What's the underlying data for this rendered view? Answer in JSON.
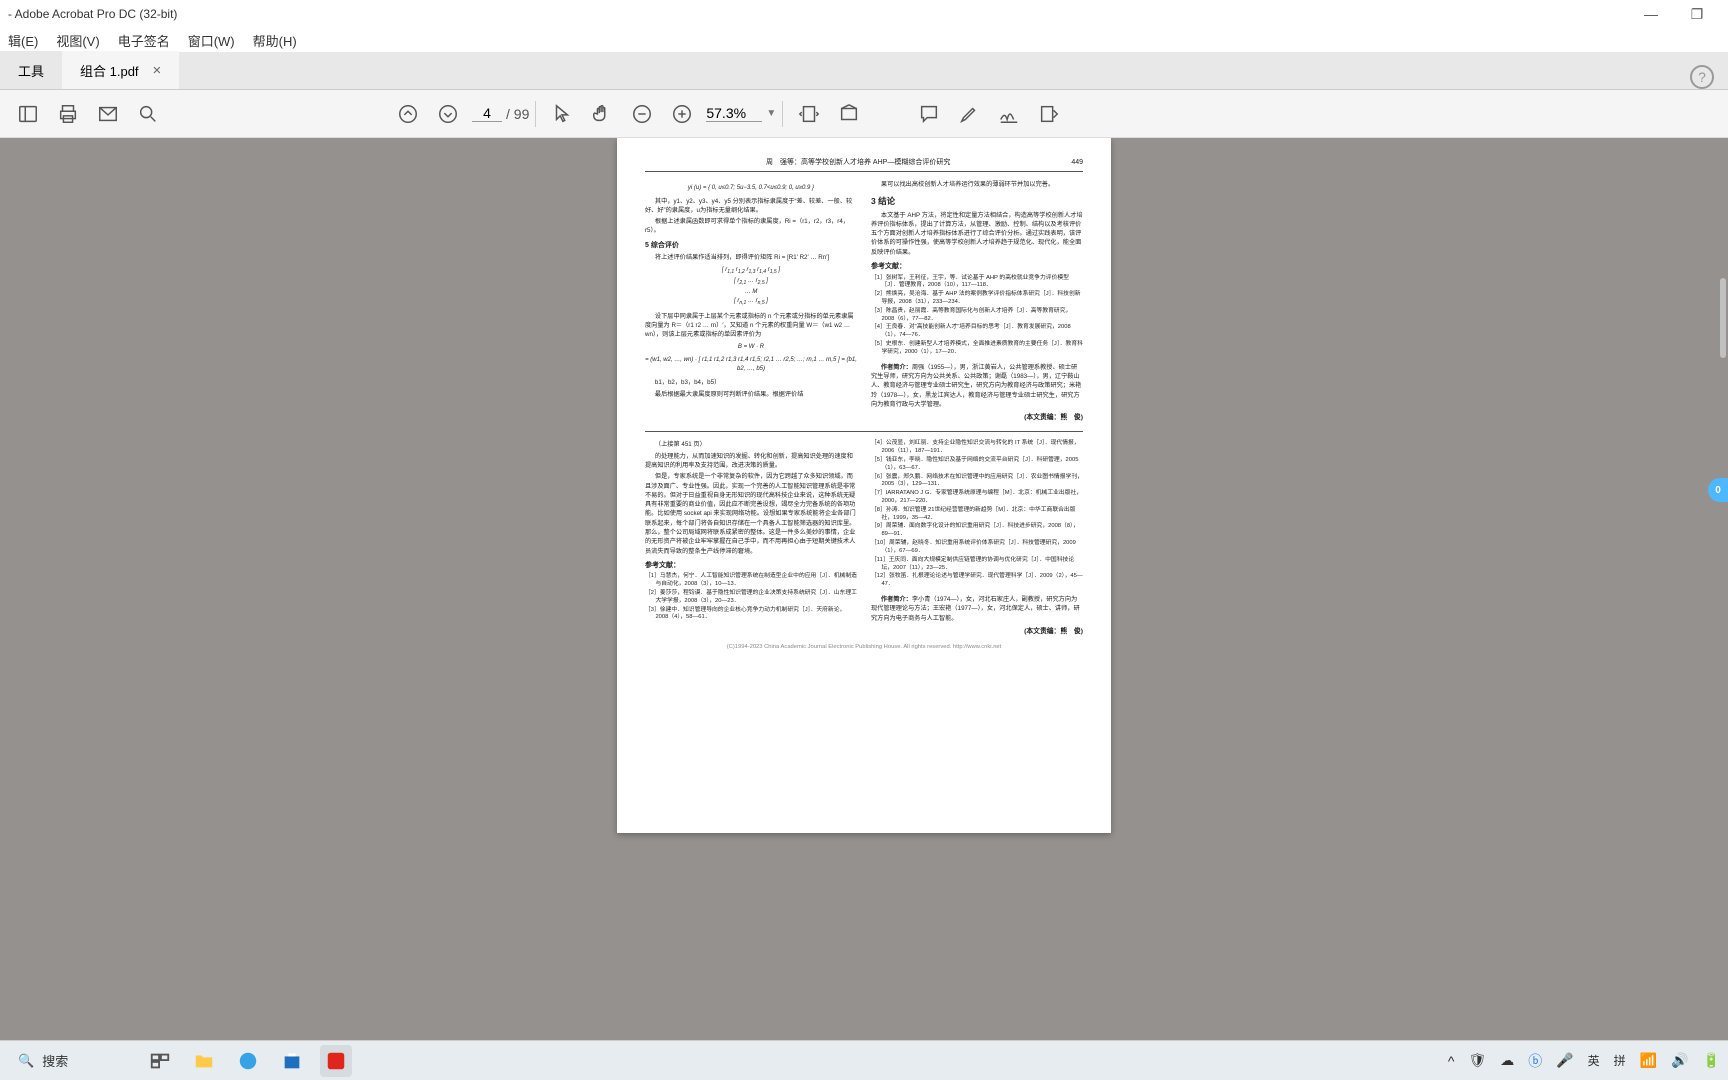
{
  "window": {
    "title": "- Adobe Acrobat Pro DC (32-bit)",
    "minimize": "—",
    "maximize": "❐",
    "close": "✕"
  },
  "menu": {
    "edit": "辑(E)",
    "view": "视图(V)",
    "esign": "电子签名",
    "window": "窗口(W)",
    "help": "帮助(H)"
  },
  "tabs": {
    "home": "工具",
    "file": "组合 1.pdf",
    "close": "×",
    "help_icon": "?"
  },
  "toolbar": {
    "page_current": "4",
    "page_sep": "/",
    "page_total": "99",
    "zoom_value": "57.3%"
  },
  "doc": {
    "running_head_center": "周　强等：高等学校创新人才培养 AHP—模糊综合评价研究",
    "page_no": "449",
    "left": {
      "formula1": "yi (u) = { 0, u≤0.7; 5u−3.5, 0.7<u≤0.9; 0, u≥0.9 }",
      "p1": "其中，y1、y2、y3、y4、y5 分别表示指标隶属度于“差、较差、一般、较好、好”的隶属度，u为指标无量纲化结果。",
      "p2": "根据上述隶属函数即可求得单个指标的隶属度，Ri =（r1，r2，r3，r4，r5）。",
      "head5": "5  综合评价",
      "p3": "将上述评价结果作适当排列，即得评价矩阵 Ri = [R1′ R2′ … Rn′]",
      "p4": "设下层中同隶属于上层某个元素或指标的 n 个元素或分指标的单元素隶属度向量为 R＝（r1 r2 … rn）′，又知道 n 个元素的权重向量 W＝（w1 w2 … wn），则该上层元素或指标的单因素评价为",
      "formula2": "B = W · R",
      "formula3": "= (w1, w2, …, wn) · [ r1,1 r1,2 r1,3 r1,4 r1,5; r2,1 … r2,5; …; rn,1 … rn,5 ] = (b1, b2, …, b5)",
      "p5": "b1，b2，b3，b4，b5）",
      "p6": "最后根据最大隶属度原则可判断评价结果。根据评价结"
    },
    "right": {
      "p1": "果可以找出高校创新人才培养运行效果的薄弱环节并加以完善。",
      "head3": "3  结论",
      "p2": "本文基于 AHP 方法，将定性和定量方法相结合，构造高等学校创新人才培养评价指标体系，提出了计算方法，从管理、激励、控制、结构以及考核评价五个方面对创新人才培养指标体系进行了综合评价分析。通过实践表明，该评价体系的可操作性强，使高等学校创新人才培养趋于规范化、现代化，能全面反映评价结果。",
      "refs_title": "参考文献：",
      "refs": [
        "［1］张树军，王利征，王宇，等．试论基于 AHP 的高校就业竞争力评价模型［J］．管理教育，2008（10），117—118．",
        "［2］熊焕亮，吴沧海．基于 AHP 法的案例教学评价指标体系研究［J］．科技创新导报，2008（31），233—234．",
        "［3］陈昌贵，赵丽霞．高等教育国际化与创新人才培养［J］．高等教育研究，2008（6），77—82．",
        "［4］王良春．对“高技能创新人才”培养目标的思考［J］．教育发展研究，2008（1），74—76．",
        "［5］史根东．创建新型人才培养模式，全面推进素质教育的主要任务［J］．教育科学研究，2000（1），17—20．"
      ],
      "author_bio_title": "作者简介：",
      "author_bio": "周强（1955—），男，浙江黄岩人，公共管理系教授、硕士研究生导师，研究方向为公共关系、公共政策；谢磊（1983—），男，辽宁鞍山人、教育经济与管理专业硕士研究生，研究方向为教育经济与政策研究；米艳玲（1978—），女，黑龙江宾达人，教育经济与管理专业硕士研究生，研究方向为教育行政与大学管理。",
      "editor": "(本文责编：熊　俊)"
    },
    "bottom_left": {
      "continue_note": "（上接第 451 页）",
      "p1": "的处理能力，从而加速知识的发掘、转化和创新，提高知识处理的速度和提高知识的利用率及支持范围，改进决策的质量。",
      "p2": "但是，专家系统是一个非常复杂的软件，因为它跨越了众多知识领域，而且涉及面广、专业性强。因此，实现一个完善的人工智能知识管理系统是非常不易的。但对于日益重视自身无形知识的现代高科技企业来说，这种系统无疑具有非常重要的商业价值，因此应不断完善设想，竭尽全力完备系统的各项功能。比如使用 socket api 来实现网络功能。设想如果专家系统能将企业各部门联系起来，每个部门将各自知识存储在一个具备人工智能筛选器的知识库里。那么，整个公司局域网将联系成紧密的整体。这是一件多么美妙的事情，企业的无形资产将被企业牢牢掌握在自己手中，而不用再担心由于短期关键技术人员流失而导致的整条生产线停滞的窘境。",
      "refs_title": "参考文献：",
      "refs": [
        "［1］马慧杰，何宁．人工智能知识管理系统在制造型企业中的应用［J］．机械制造与自动化，2008（3），10—13．",
        "［2］姜莎莎，程钧谟．基于隐性知识管理的企业决策支持系统研究［J］．山东理工大学学报，2008（3），20—23．",
        "［3］徐建中．知识管理导向的企业核心竞争力动力机制研究［J］．天府新论，2008（4），58—61．"
      ]
    },
    "bottom_right": {
      "refs": [
        "［4］公茂显，刘红丽．支持企业隐性知识交流与转化的 IT 系统［J］．现代情报，2006（11），187—191．",
        "［5］钱亚东，李晓．隐性知识及基于网络的交流平台研究［J］．科研管理，2005（1），63—67．",
        "［6］张震，郑久鹏．网络技术在知识管理中的应用研究［J］．农业图书情报学刊，2005（3），129—131．",
        "［7］IARRATANO J G．专家管理系统原理与编程［M］．北京：机械工业出版社，2000，217—220．",
        "［8］孙涛．知识管理 21世纪经营管理的新趋势［M］．北京：中华工商联合出版社，1999，35—42．",
        "［9］周荣辅．面向数字化设计的知识重用研究［J］．科技进步研究，2008（8），89—91．",
        "［10］周荣辅，赵晓冬．知识重用系统评价体系研究［J］．科技管理研究，2009（1），67—69．",
        "［11］王庆同．面向大规模定制供应链管理的协调与优化研究［J］．中国科技论坛，2007（11），23—25．",
        "［12］张牧笛．扎根理论论述与管理学研究．现代管理科学［J］．2009（2），45—47．"
      ],
      "author_bio_title": "作者简介：",
      "author_bio": "李小青（1974—），女，河北石家庄人，副教授，研究方向为现代管理理论与方法；王宏艳（1977—），女，河北保定人，硕士、讲师，研究方向为电子商务与人工智能。",
      "editor": "(本文责编：熊　俊)"
    },
    "footer": "(C)1994-2023 China Academic Journal Electronic Publishing House. All rights reserved.    http://www.cnki.net"
  },
  "floating_badge": "0",
  "taskbar": {
    "search_icon": "🔍",
    "search_placeholder": "搜索",
    "tray": {
      "chevron": "^",
      "shield": "🛡",
      "cloud": "☁",
      "bt": "ⓑ",
      "mic": "🎤",
      "ime": "英",
      "input": "拼",
      "wifi": "📶",
      "vol": "🔊",
      "bat": "🔋"
    }
  }
}
